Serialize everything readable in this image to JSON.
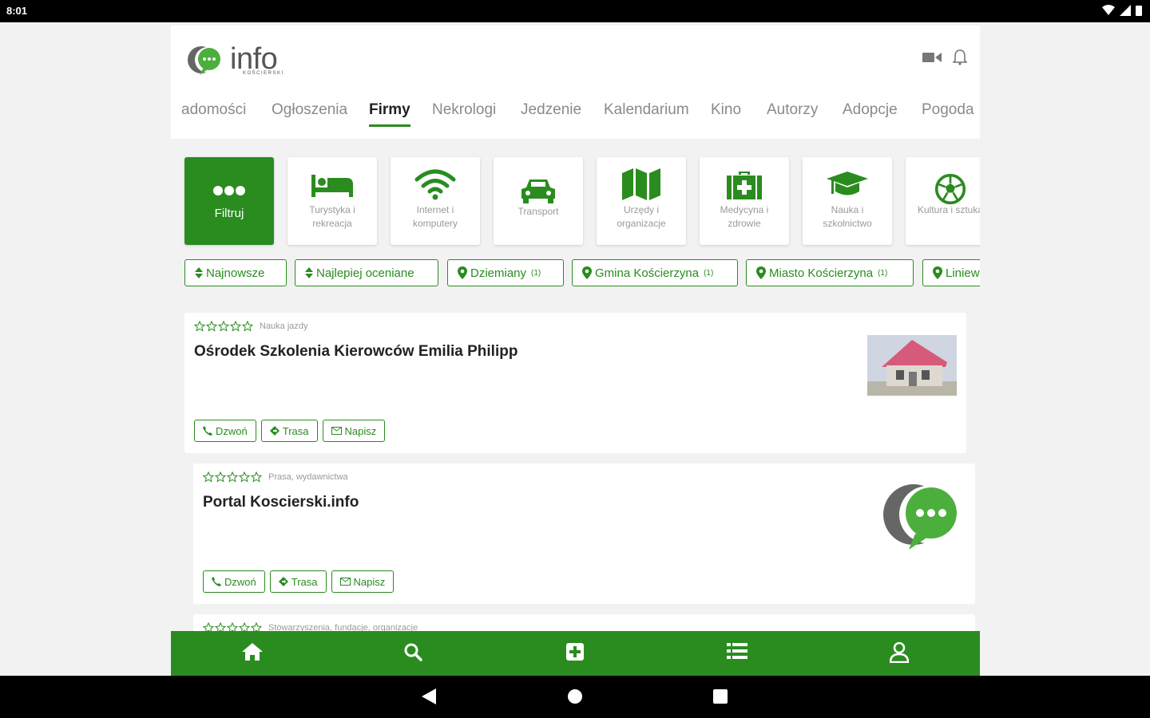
{
  "status": {
    "time": "8:01"
  },
  "logo": {
    "word": "info",
    "sub": "KOŚCIERSKI"
  },
  "tabs": [
    {
      "label": "adomości",
      "active": false
    },
    {
      "label": "Ogłoszenia",
      "active": false
    },
    {
      "label": "Firmy",
      "active": true
    },
    {
      "label": "Nekrologi",
      "active": false
    },
    {
      "label": "Jedzenie",
      "active": false
    },
    {
      "label": "Kalendarium",
      "active": false
    },
    {
      "label": "Kino",
      "active": false
    },
    {
      "label": "Autorzy",
      "active": false
    },
    {
      "label": "Adopcje",
      "active": false
    },
    {
      "label": "Pogoda",
      "active": false
    }
  ],
  "categories": [
    {
      "label": "Filtruj",
      "icon": "dots-icon",
      "active": true
    },
    {
      "label": "Turystyka i rekreacja",
      "icon": "bed-icon",
      "active": false
    },
    {
      "label": "Internet i komputery",
      "icon": "wifi-icon",
      "active": false
    },
    {
      "label": "Transport",
      "icon": "car-icon",
      "active": false
    },
    {
      "label": "Urzędy i organizacje",
      "icon": "map-icon",
      "active": false
    },
    {
      "label": "Medycyna i zdrowie",
      "icon": "medkit-icon",
      "active": false
    },
    {
      "label": "Nauka i szkolnictwo",
      "icon": "graduation-cap-icon",
      "active": false
    },
    {
      "label": "Kultura i sztuka",
      "icon": "soccer-ball-icon",
      "active": false
    }
  ],
  "filters": [
    {
      "label": "Najnowsze",
      "icon": "sort-icon",
      "count": ""
    },
    {
      "label": "Najlepiej oceniane",
      "icon": "sort-icon",
      "count": ""
    },
    {
      "label": "Dziemiany",
      "icon": "pin-icon",
      "count": "(1)"
    },
    {
      "label": "Gmina Kościerzyna",
      "icon": "pin-icon",
      "count": "(1)"
    },
    {
      "label": "Miasto Kościerzyna",
      "icon": "pin-icon",
      "count": "(1)"
    },
    {
      "label": "Liniewo",
      "icon": "pin-icon",
      "count": ""
    }
  ],
  "listings": [
    {
      "category": "Nauka jazdy",
      "title": "Ośrodek Szkolenia Kierowców Emilia Philipp",
      "rating": 0,
      "thumb": "house"
    },
    {
      "category": "Prasa, wydawnictwa",
      "title": "Portal Koscierski.info",
      "rating": 0,
      "thumb": "logo"
    },
    {
      "category": "Stowarzyszenia, fundacje, organizacje",
      "title": "",
      "rating": 0,
      "thumb": "none"
    }
  ],
  "actions": {
    "call": "Dzwoń",
    "route": "Trasa",
    "write": "Napisz"
  },
  "colors": {
    "brand": "#2a8c1f",
    "muted": "#9a9a9a"
  },
  "bottom_nav": [
    "home-icon",
    "search-icon",
    "add-icon",
    "list-icon",
    "user-icon"
  ]
}
